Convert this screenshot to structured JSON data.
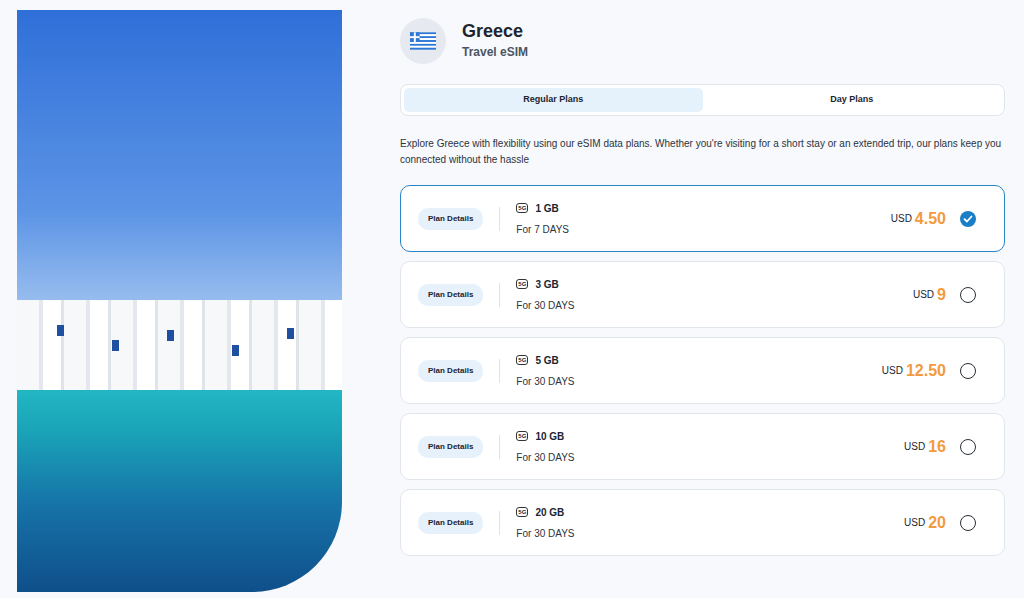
{
  "country": {
    "name": "Greece",
    "subtitle": "Travel eSIM"
  },
  "tabs": [
    {
      "label": "Regular Plans",
      "selected": true
    },
    {
      "label": "Day Plans",
      "selected": false
    }
  ],
  "description": "Explore Greece with flexibility using our eSIM data plans. Whether you're visiting for a short stay or an extended trip, our plans keep you connected without the hassle",
  "plans": [
    {
      "details": "Plan Details",
      "network": "5G",
      "data": "1 GB",
      "duration": "For 7 DAYS",
      "currency": "USD",
      "price": "4.50",
      "selected": true
    },
    {
      "details": "Plan Details",
      "network": "5G",
      "data": "3 GB",
      "duration": "For 30 DAYS",
      "currency": "USD",
      "price": "9",
      "selected": false
    },
    {
      "details": "Plan Details",
      "network": "5G",
      "data": "5 GB",
      "duration": "For 30 DAYS",
      "currency": "USD",
      "price": "12.50",
      "selected": false
    },
    {
      "details": "Plan Details",
      "network": "5G",
      "data": "10 GB",
      "duration": "For 30 DAYS",
      "currency": "USD",
      "price": "16",
      "selected": false
    },
    {
      "details": "Plan Details",
      "network": "5G",
      "data": "20 GB",
      "duration": "For 30 DAYS",
      "currency": "USD",
      "price": "20",
      "selected": false
    }
  ]
}
